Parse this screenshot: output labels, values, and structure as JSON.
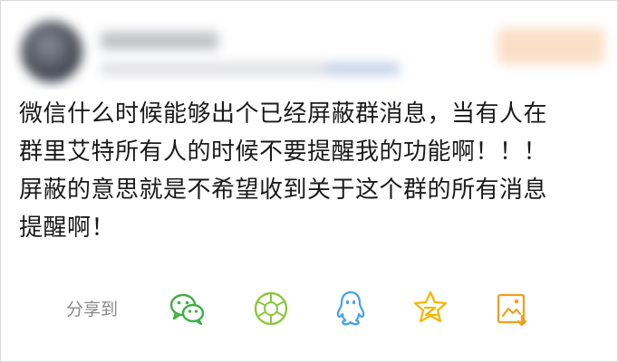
{
  "post": {
    "lines": [
      "微信什么时候能够出个已经屏蔽群消息，当有人在",
      "群里艾特所有人的时候不要提醒我的功能啊！！！",
      "屏蔽的意思就是不希望收到关于这个群的所有消息",
      "提醒啊！"
    ]
  },
  "share": {
    "label": "分享到",
    "targets": [
      {
        "icon": "wechat-icon",
        "color": "#3cb043"
      },
      {
        "icon": "moments-icon",
        "color": "#8cc63f"
      },
      {
        "icon": "qq-icon",
        "color": "#4aa3e8"
      },
      {
        "icon": "qzone-icon",
        "color": "#f5b800"
      },
      {
        "icon": "weibo-icon",
        "color": "#f0a020"
      }
    ]
  }
}
